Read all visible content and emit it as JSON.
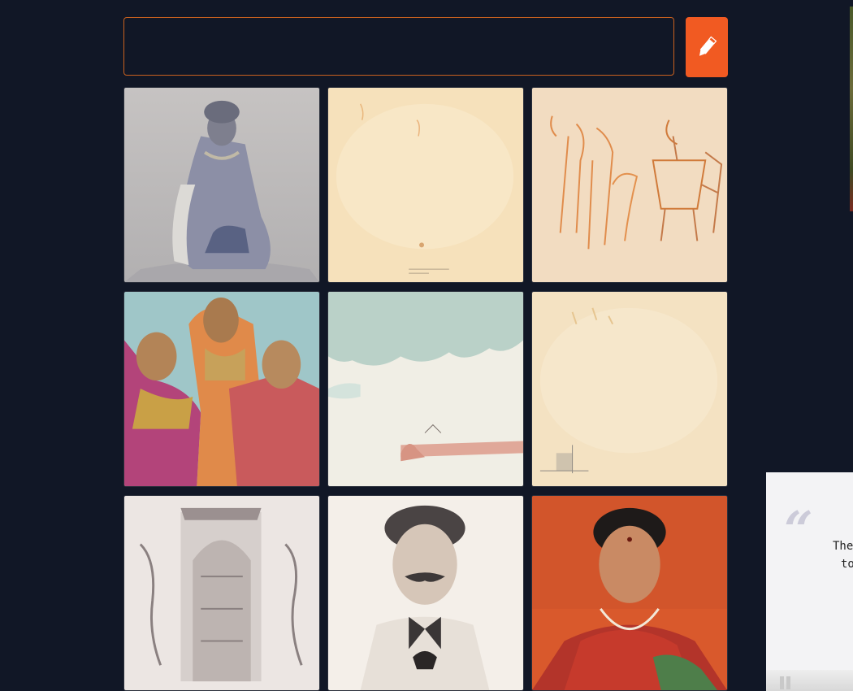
{
  "search": {
    "value": "",
    "placeholder": ""
  },
  "edit_button": {
    "icon": "pencil-icon",
    "color": "#f15a22"
  },
  "gallery": {
    "tiles": [
      {
        "subject": "seated-woman-sketch"
      },
      {
        "subject": "faded-blank-paper"
      },
      {
        "subject": "figures-and-chair-sketch"
      },
      {
        "subject": "three-women-figurines"
      },
      {
        "subject": "sky-landscape-watercolor"
      },
      {
        "subject": "faded-paper-sheet"
      },
      {
        "subject": "temple-doorway-engraving"
      },
      {
        "subject": "man-portrait-sketch"
      },
      {
        "subject": "woman-red-saree-portrait"
      }
    ]
  },
  "quote": {
    "icon": "quote-mark-icon",
    "line1": "The",
    "line2": "to",
    "control": "pause-icon"
  }
}
